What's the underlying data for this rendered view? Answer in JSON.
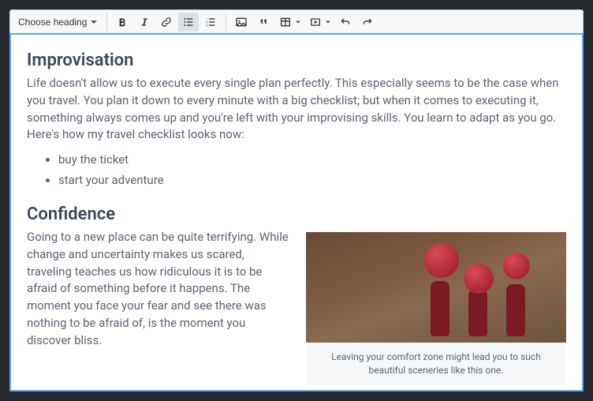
{
  "toolbar": {
    "heading_placeholder": "Choose heading"
  },
  "article": {
    "h1": "Improvisation",
    "p1": "Life doesn't allow us to execute every single plan perfectly. This especially seems to be the case when you travel. You plan it down to every minute with a big checklist; but when it comes to executing it, something always comes up and you're left with your improvising skills. You learn to adapt as you go. Here's how my travel checklist looks now:",
    "li1": "buy the ticket",
    "li2": "start your adventure",
    "h2": "Confidence",
    "p2": "Going to a new place can be quite terrifying. While change and uncertainty makes us scared, traveling teaches us how ridiculous it is to be afraid of something before it happens. The moment you face your fear and see there was nothing to be afraid of, is the moment you discover bliss.",
    "caption": "Leaving your comfort zone might lead you to such beautiful sceneries like this one."
  }
}
